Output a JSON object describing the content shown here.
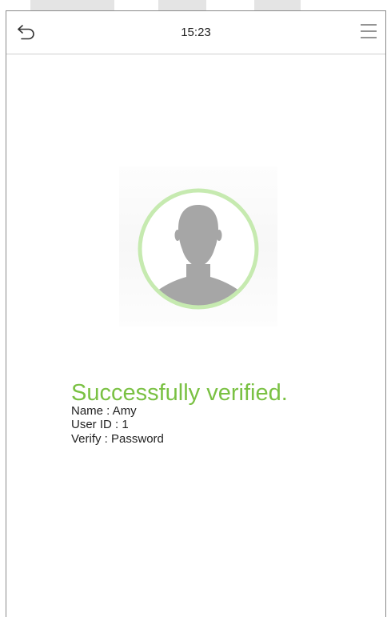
{
  "status_bar": {
    "time": "15:23"
  },
  "icons": {
    "back": "back-arrow-icon",
    "menu": "hamburger-menu-icon",
    "avatar": "user-silhouette-icon"
  },
  "result": {
    "title": "Successfully verified.",
    "name_line": "Name : Amy",
    "user_id_line": "User ID : 1",
    "verify_line": "Verify : Password"
  },
  "colors": {
    "success": "#7ac143",
    "ring": "#c6eab0",
    "silhouette": "#a6a6a6"
  }
}
